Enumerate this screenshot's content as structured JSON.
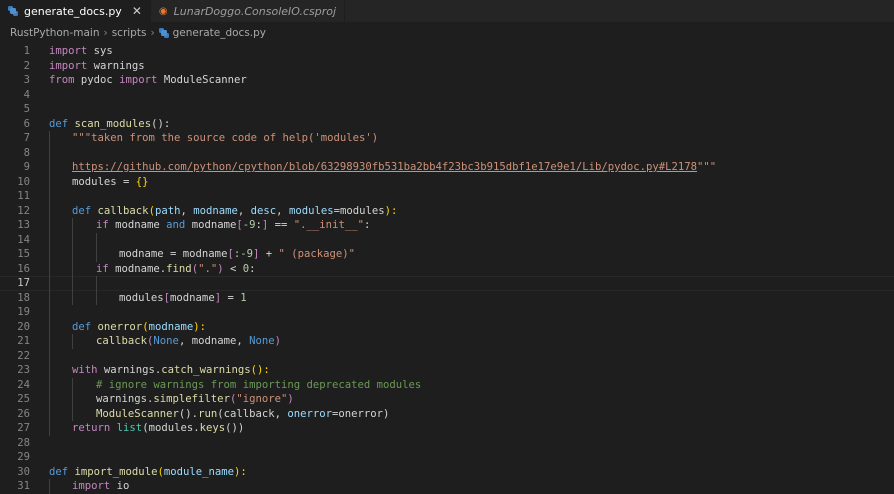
{
  "tabs": [
    {
      "label": "generate_docs.py",
      "active": true,
      "icon": "python-icon"
    },
    {
      "label": "LunarDoggo.ConsoleIO.csproj",
      "active": false,
      "icon": "rss-icon"
    }
  ],
  "breadcrumb": {
    "root": "RustPython-main",
    "folder": "scripts",
    "file": "generate_docs.py"
  },
  "editor": {
    "current_line": 17,
    "lines": [
      {
        "n": "1"
      },
      {
        "n": "2"
      },
      {
        "n": "3"
      },
      {
        "n": "4"
      },
      {
        "n": "5"
      },
      {
        "n": "6"
      },
      {
        "n": "7"
      },
      {
        "n": "8"
      },
      {
        "n": "9"
      },
      {
        "n": "10"
      },
      {
        "n": "11"
      },
      {
        "n": "12"
      },
      {
        "n": "13"
      },
      {
        "n": "14"
      },
      {
        "n": "15"
      },
      {
        "n": "16"
      },
      {
        "n": "17"
      },
      {
        "n": "18"
      },
      {
        "n": "19"
      },
      {
        "n": "20"
      },
      {
        "n": "21"
      },
      {
        "n": "22"
      },
      {
        "n": "23"
      },
      {
        "n": "24"
      },
      {
        "n": "25"
      },
      {
        "n": "26"
      },
      {
        "n": "27"
      },
      {
        "n": "28"
      },
      {
        "n": "29"
      },
      {
        "n": "30"
      },
      {
        "n": "31"
      }
    ],
    "tokens": {
      "l1": [
        "import",
        " sys"
      ],
      "l2": [
        "import",
        " warnings"
      ],
      "l3": [
        "from",
        " pydoc ",
        "import",
        " ModuleScanner"
      ],
      "l6": [
        "def",
        " ",
        "scan_modules",
        "():"
      ],
      "l7": [
        "\"\"\"taken from the source code of help('modules')"
      ],
      "l9": [
        "https://github.com/python/cpython/blob/63298930fb531ba2bb4f23bc3b915dbf1e17e9e1/Lib/pydoc.py#L2178",
        "\"\"\""
      ],
      "l10": [
        "modules",
        " = ",
        "{}"
      ],
      "l12": [
        "def",
        " ",
        "callback",
        "(",
        "path",
        ", ",
        "modname",
        ", ",
        "desc",
        ", ",
        "modules",
        "=",
        "modules",
        "):"
      ],
      "l13": [
        "if",
        " modname ",
        "and",
        " modname",
        "[",
        "-9",
        ":",
        "]",
        " == ",
        "\".__init__\"",
        ":"
      ],
      "l15": [
        "modname",
        " = ",
        "modname",
        "[",
        ":-9",
        "]",
        " + ",
        "\" (package)\""
      ],
      "l16": [
        "if",
        " modname.",
        "find",
        "(",
        "\".\"",
        ")",
        " < ",
        "0",
        ":"
      ],
      "l18": [
        "modules",
        "[",
        "modname",
        "]",
        " = ",
        "1"
      ],
      "l20": [
        "def",
        " ",
        "onerror",
        "(",
        "modname",
        "):"
      ],
      "l21": [
        "callback",
        "(",
        "None",
        ", modname, ",
        "None",
        ")"
      ],
      "l23": [
        "with",
        " warnings.",
        "catch_warnings",
        "():"
      ],
      "l24": [
        "# ignore warnings from importing deprecated modules"
      ],
      "l25": [
        "warnings.",
        "simplefilter",
        "(",
        "\"ignore\"",
        ")"
      ],
      "l26": [
        "ModuleScanner",
        "().",
        "run",
        "(callback, ",
        "onerror",
        "=onerror)"
      ],
      "l27": [
        "return",
        " ",
        "list",
        "(modules.",
        "keys",
        "())"
      ],
      "l30": [
        "def",
        " ",
        "import_module",
        "(",
        "module_name",
        "):"
      ],
      "l31": [
        "import",
        " io"
      ]
    }
  }
}
